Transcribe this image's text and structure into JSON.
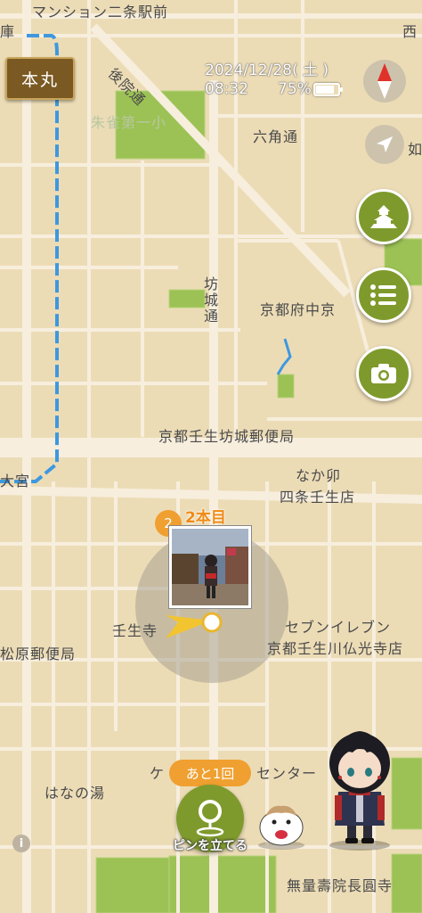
{
  "header": {
    "honmaru_button": "本丸",
    "date": "2024/12/28( 土 )",
    "time": "08:32",
    "battery_percent": "75%",
    "battery_level": 0.75
  },
  "map_labels": {
    "top_mansion": "マンション二条駅前",
    "top_left": "庫",
    "top_right": "西",
    "gojoin_street": "後院通",
    "school": "朱雀第一小",
    "rokkaku_street": "六角通",
    "right_partial": "如",
    "bojo_street": "坊城通",
    "kyoto_fuchu": "京都府中京",
    "post_office_mibu": "京都壬生坊城郵便局",
    "omiya": "大宮",
    "nakau_line1": "なか卯",
    "nakau_line2": "四条壬生店",
    "mibudera": "壬生寺",
    "seven_line1": "セブンイレブン",
    "seven_line2": "京都壬生川仏光寺店",
    "matsubara_post": "松原郵便局",
    "center_partial": "ケ",
    "center": "センター",
    "hanano_yu": "はなの湯",
    "muryojuin": "無量壽院長圓寺"
  },
  "pin": {
    "count_badge": "2",
    "label": "2本目"
  },
  "bottom": {
    "remaining_badge": "あと1回",
    "place_pin_label": "ピンを立てる",
    "info_icon": "i"
  },
  "colors": {
    "map_bg": "#ecdcb6",
    "road": "#f7eedd",
    "park": "#9cc255",
    "river": "#3d98e0",
    "accent_green": "#7f9a2c",
    "pin_orange": "#f0a030",
    "honmaru_bg": "#7a5a22"
  }
}
